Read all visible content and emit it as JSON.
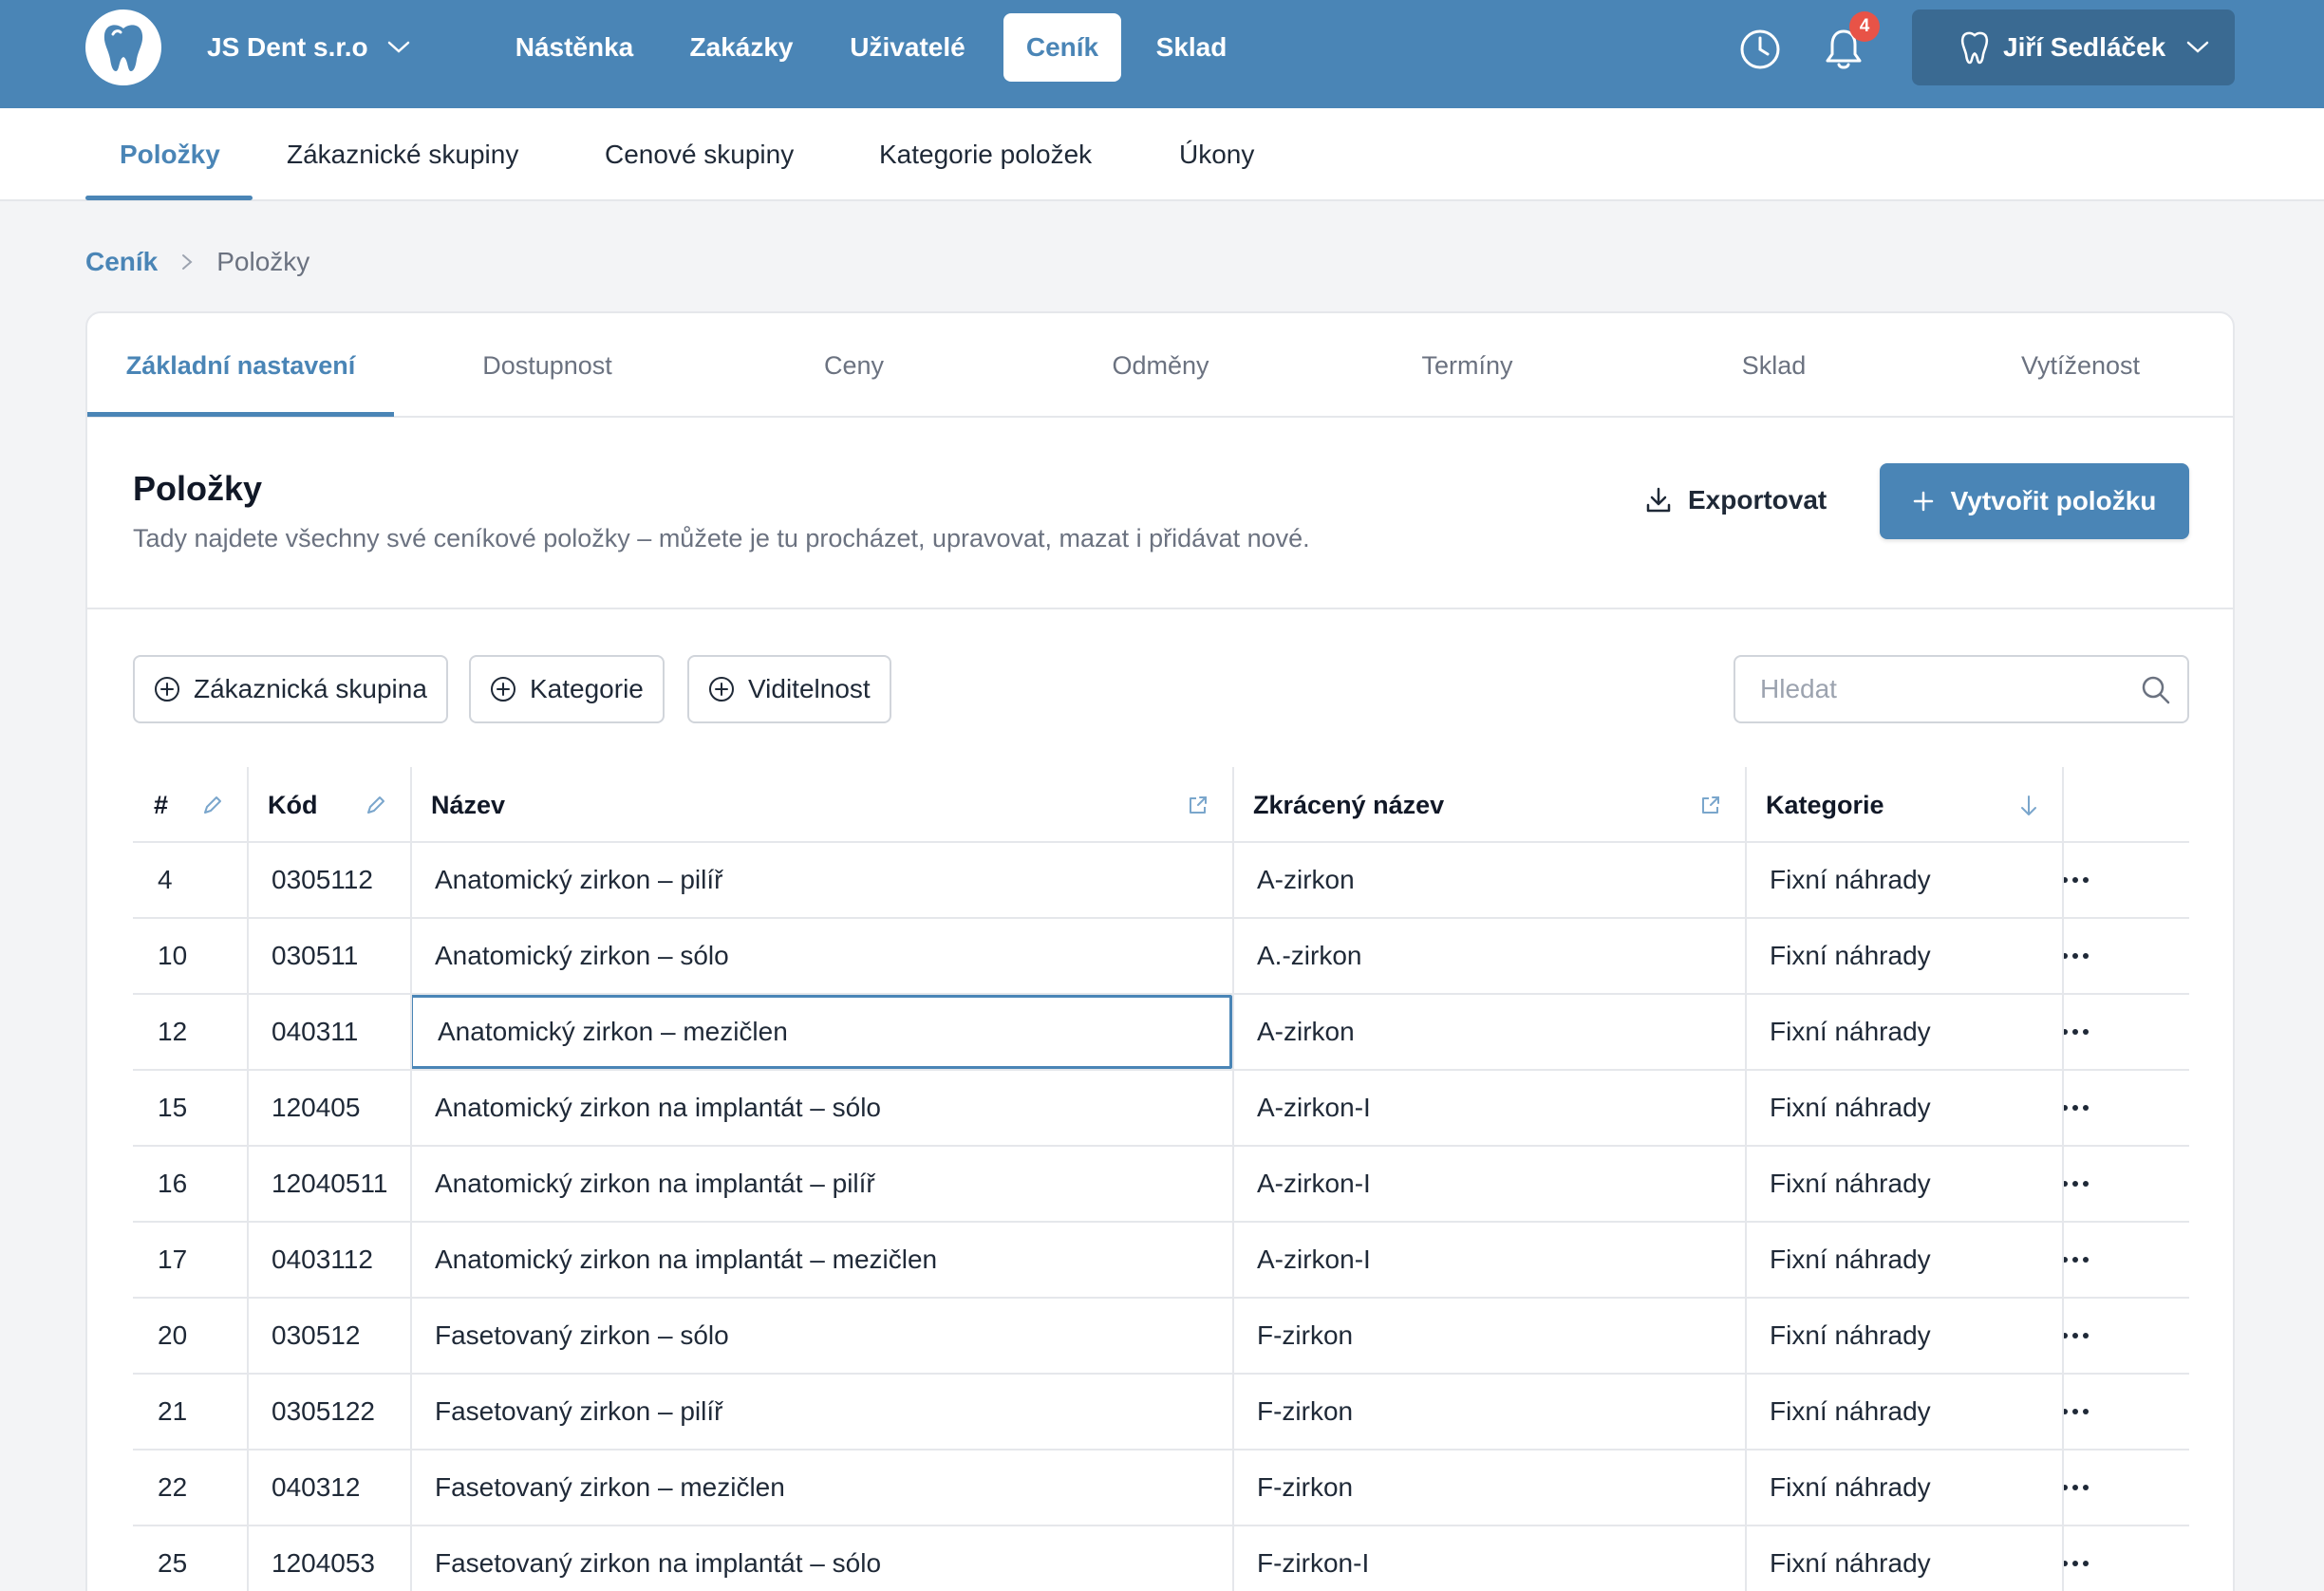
{
  "company": {
    "name": "JS Dent s.r.o"
  },
  "main_nav": [
    {
      "label": "Nástěnka",
      "active": false
    },
    {
      "label": "Zakázky",
      "active": false
    },
    {
      "label": "Uživatelé",
      "active": false
    },
    {
      "label": "Ceník",
      "active": true
    },
    {
      "label": "Sklad",
      "active": false
    }
  ],
  "notifications": {
    "count": "4"
  },
  "user": {
    "name": "Jiří Sedláček"
  },
  "sub_nav": [
    {
      "label": "Položky",
      "active": true
    },
    {
      "label": "Zákaznické skupiny",
      "active": false
    },
    {
      "label": "Cenové skupiny",
      "active": false
    },
    {
      "label": "Kategorie položek",
      "active": false
    },
    {
      "label": "Úkony",
      "active": false
    }
  ],
  "breadcrumb": {
    "parent": "Ceník",
    "current": "Položky"
  },
  "tabs": [
    {
      "label": "Základní nastavení",
      "active": true
    },
    {
      "label": "Dostupnost",
      "active": false
    },
    {
      "label": "Ceny",
      "active": false
    },
    {
      "label": "Odměny",
      "active": false
    },
    {
      "label": "Termíny",
      "active": false
    },
    {
      "label": "Sklad",
      "active": false
    },
    {
      "label": "Vytíženost",
      "active": false
    }
  ],
  "section": {
    "title": "Položky",
    "description": "Tady najdete všechny své ceníkové položky – můžete je tu procházet, upravovat, mazat i přidávat nové.",
    "export_label": "Exportovat",
    "create_label": "Vytvořit položku"
  },
  "filters": [
    {
      "label": "Zákaznická skupina"
    },
    {
      "label": "Kategorie"
    },
    {
      "label": "Viditelnost"
    }
  ],
  "search": {
    "placeholder": "Hledat",
    "value": ""
  },
  "table": {
    "columns": [
      "#",
      "Kód",
      "Název",
      "Zkrácený název",
      "Kategorie"
    ],
    "selected_row": 2,
    "rows": [
      {
        "id": "4",
        "code": "0305112",
        "name": "Anatomický zirkon – pilíř",
        "short": "A-zirkon",
        "category": "Fixní náhrady"
      },
      {
        "id": "10",
        "code": "030511",
        "name": "Anatomický zirkon – sólo",
        "short": "A.-zirkon",
        "category": "Fixní náhrady"
      },
      {
        "id": "12",
        "code": "040311",
        "name": "Anatomický zirkon – mezičlen",
        "short": "A-zirkon",
        "category": "Fixní náhrady"
      },
      {
        "id": "15",
        "code": "120405",
        "name": "Anatomický zirkon na implantát – sólo",
        "short": "A-zirkon-I",
        "category": "Fixní náhrady"
      },
      {
        "id": "16",
        "code": "12040511",
        "name": "Anatomický zirkon na implantát – pilíř",
        "short": "A-zirkon-I",
        "category": "Fixní náhrady"
      },
      {
        "id": "17",
        "code": "0403112",
        "name": "Anatomický zirkon na implantát – mezičlen",
        "short": "A-zirkon-I",
        "category": "Fixní náhrady"
      },
      {
        "id": "20",
        "code": "030512",
        "name": "Fasetovaný zirkon – sólo",
        "short": "F-zirkon",
        "category": "Fixní náhrady"
      },
      {
        "id": "21",
        "code": "0305122",
        "name": "Fasetovaný zirkon – pilíř",
        "short": "F-zirkon",
        "category": "Fixní náhrady"
      },
      {
        "id": "22",
        "code": "040312",
        "name": "Fasetovaný zirkon – mezičlen",
        "short": "F-zirkon",
        "category": "Fixní náhrady"
      },
      {
        "id": "25",
        "code": "1204053",
        "name": "Fasetovaný zirkon na implantát – sólo",
        "short": "F-zirkon-I",
        "category": "Fixní náhrady"
      }
    ]
  },
  "colors": {
    "accent": "#4a85b6",
    "badge": "#e85347",
    "user_button": "#3a6a92"
  }
}
